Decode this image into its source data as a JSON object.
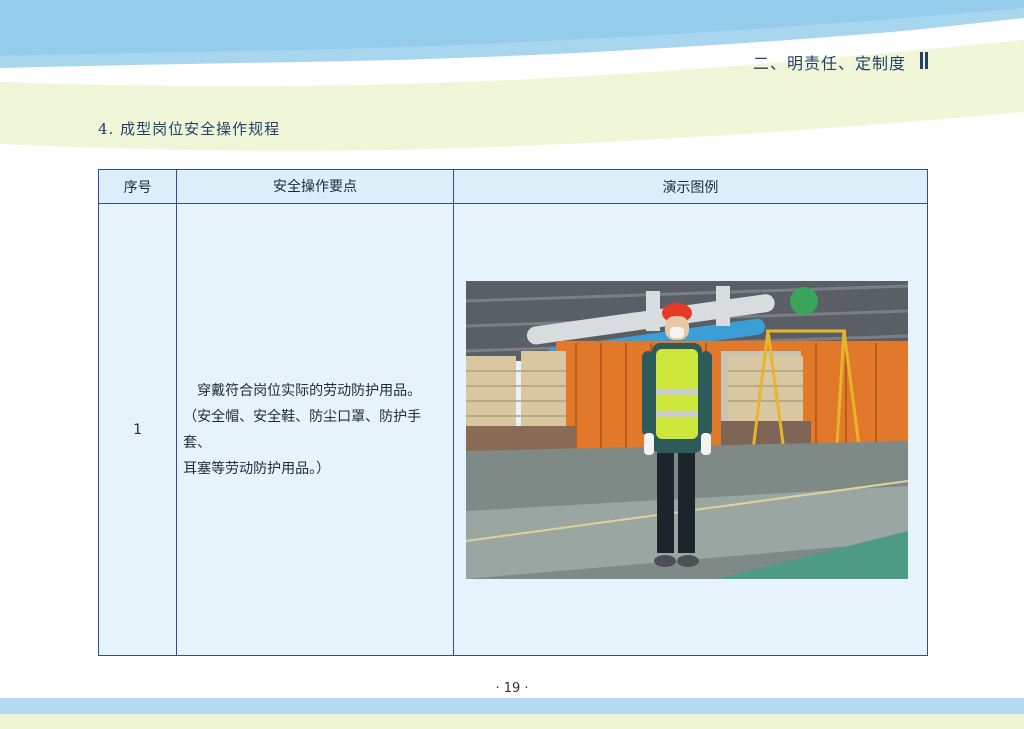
{
  "header": {
    "section_label": "二、明责任、定制度"
  },
  "page": {
    "subtitle": "4. 成型岗位安全操作规程"
  },
  "table": {
    "headers": [
      "序号",
      "安全操作要点",
      "演示图例"
    ],
    "rows": [
      {
        "no": "1",
        "point_lines": [
          "穿戴符合岗位实际的劳动防护用品。",
          "（安全帽、安全鞋、防尘口罩、防护手套、",
          "耳塞等劳动防护用品。）"
        ]
      }
    ]
  },
  "footer": {
    "page_number": "· 19 ·"
  },
  "colors": {
    "accent": "#23406b",
    "table_border": "#2d4f8a",
    "table_fill": "#e7f3fb"
  }
}
